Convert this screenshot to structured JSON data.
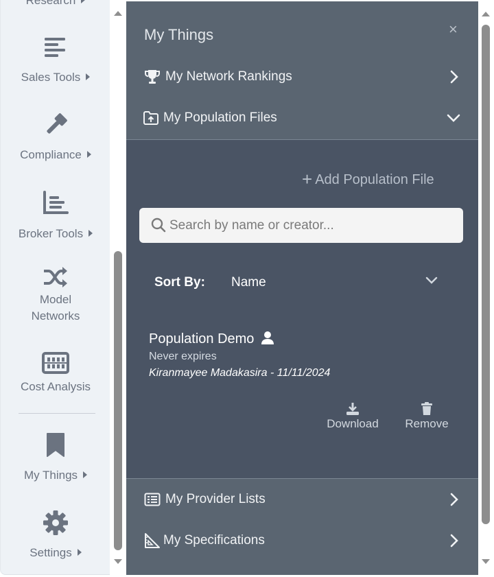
{
  "sidebar": {
    "items": [
      {
        "label": "Research",
        "icon": "research-icon",
        "has_submenu": true
      },
      {
        "label": "Sales Tools",
        "icon": "align-left-icon",
        "has_submenu": true
      },
      {
        "label": "Compliance",
        "icon": "gavel-icon",
        "has_submenu": true
      },
      {
        "label": "Broker Tools",
        "icon": "bar-chart-icon",
        "has_submenu": true
      },
      {
        "label_line1": "Model",
        "label_line2": "Networks",
        "icon": "shuffle-icon",
        "has_submenu": false
      },
      {
        "label": "Cost Analysis",
        "icon": "abacus-icon",
        "has_submenu": false
      },
      {
        "label": "My Things",
        "icon": "bookmark-icon",
        "has_submenu": true
      },
      {
        "label": "Settings",
        "icon": "gear-icon",
        "has_submenu": true
      }
    ]
  },
  "panel": {
    "title": "My Things",
    "close_label": "×",
    "sections": {
      "network_rankings": {
        "label": "My Network Rankings",
        "icon": "trophy-icon",
        "state": "collapsed"
      },
      "population_files": {
        "label": "My Population Files",
        "icon": "folder-upload-icon",
        "state": "expanded"
      },
      "provider_lists": {
        "label": "My Provider Lists",
        "icon": "list-icon",
        "state": "collapsed"
      },
      "specifications": {
        "label": "My Specifications",
        "icon": "ruler-triangle-icon",
        "state": "collapsed"
      }
    },
    "population": {
      "add_label": "Add Population File",
      "search_placeholder": "Search by name or creator...",
      "search_value": "",
      "sort_label": "Sort By:",
      "sort_value": "Name",
      "files": [
        {
          "name": "Population Demo",
          "owner_icon": "user-icon",
          "expiry": "Never expires",
          "meta": "Kiranmayee Madakasira - 11/11/2024",
          "download_label": "Download",
          "remove_label": "Remove"
        }
      ]
    }
  },
  "colors": {
    "sidebar_bg": "#eef2f6",
    "sidebar_text": "#6b7380",
    "panel_bg": "#5a6571",
    "expanded_bg": "#4a5464",
    "scrollbar_thumb": "#8d8d8d"
  }
}
